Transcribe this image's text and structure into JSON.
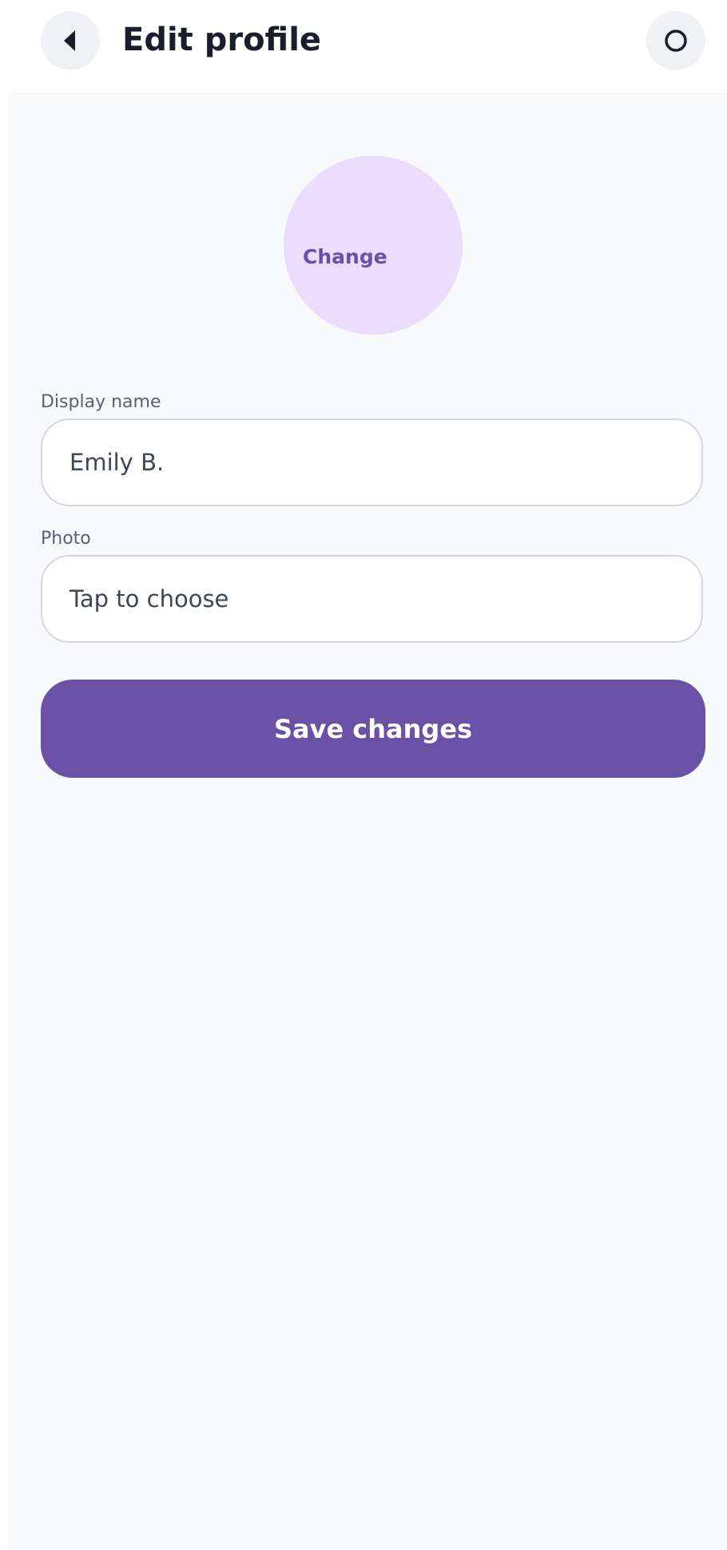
{
  "header": {
    "title": "Edit profile",
    "back_icon": "back-arrow-icon",
    "settings_icon": "circle-icon"
  },
  "avatar": {
    "change_label": "Change"
  },
  "form": {
    "display_name": {
      "label": "Display name",
      "value": "Emily B."
    },
    "photo": {
      "label": "Photo",
      "value": "Tap to choose"
    },
    "save_label": "Save changes"
  },
  "colors": {
    "accent": "#6a51a5",
    "avatar_bg": "#ecdcfd",
    "content_bg": "#f8f9fa",
    "title_text": "#1a1d2b"
  }
}
